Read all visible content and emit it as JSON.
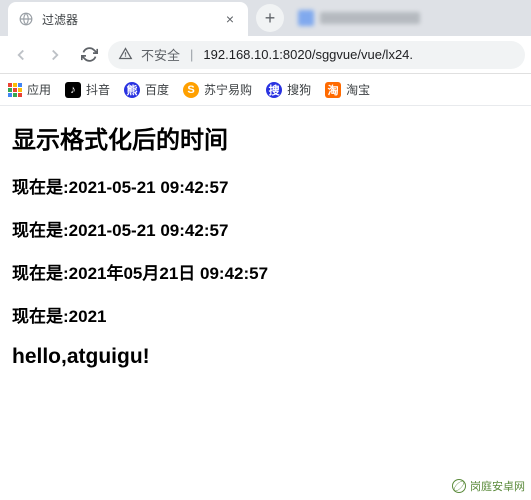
{
  "browser": {
    "tab": {
      "title": "过滤器"
    },
    "toolbar": {
      "security_text": "不安全",
      "url": "192.168.10.1:8020/sggvue/vue/lx24."
    },
    "bookmarks": {
      "apps": "应用",
      "douyin": "抖音",
      "baidu": "百度",
      "suning": "苏宁易购",
      "sougou": "搜狗",
      "taobao": "淘宝"
    }
  },
  "page": {
    "heading": "显示格式化后的时间",
    "lines": {
      "l1": "现在是:2021-05-21 09:42:57",
      "l2": "现在是:2021-05-21 09:42:57",
      "l3": "现在是:2021年05月21日 09:42:57",
      "l4": "现在是:2021"
    },
    "footer": "hello,atguigu!"
  },
  "watermark": "岗庭安卓网"
}
